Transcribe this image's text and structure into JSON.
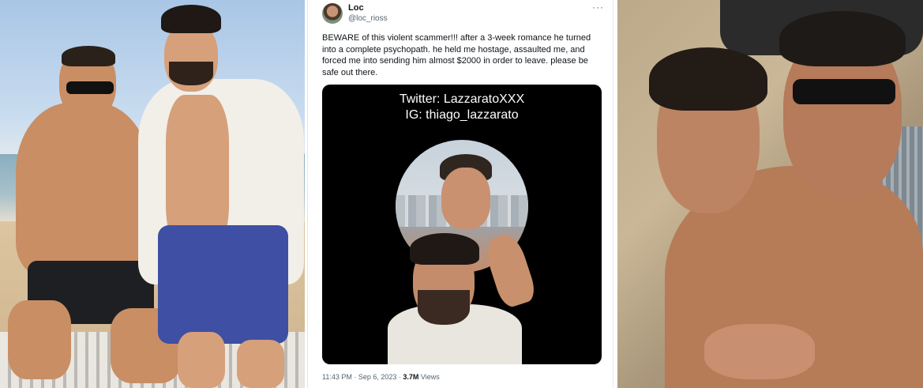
{
  "tweet": {
    "name": "Loc",
    "handle": "@loc_rioss",
    "text": "BEWARE of this violent scammer!!! after a 3-week romance he turned into a complete psychopath. he held me hostage, assaulted me, and forced me into sending him almost $2000 in order to leave. please be safe out there.",
    "media_caption_line1": "Twitter: LazzaratoXXX",
    "media_caption_line2": "IG: thiago_lazzarato",
    "time": "11:43 PM · Sep 6, 2023 · ",
    "views_count": "3.7M",
    "views_label": " Views",
    "more_icon": "more-icon"
  },
  "colors": {
    "text_primary": "#0f1419",
    "text_secondary": "#536471",
    "media_bg": "#000000"
  }
}
